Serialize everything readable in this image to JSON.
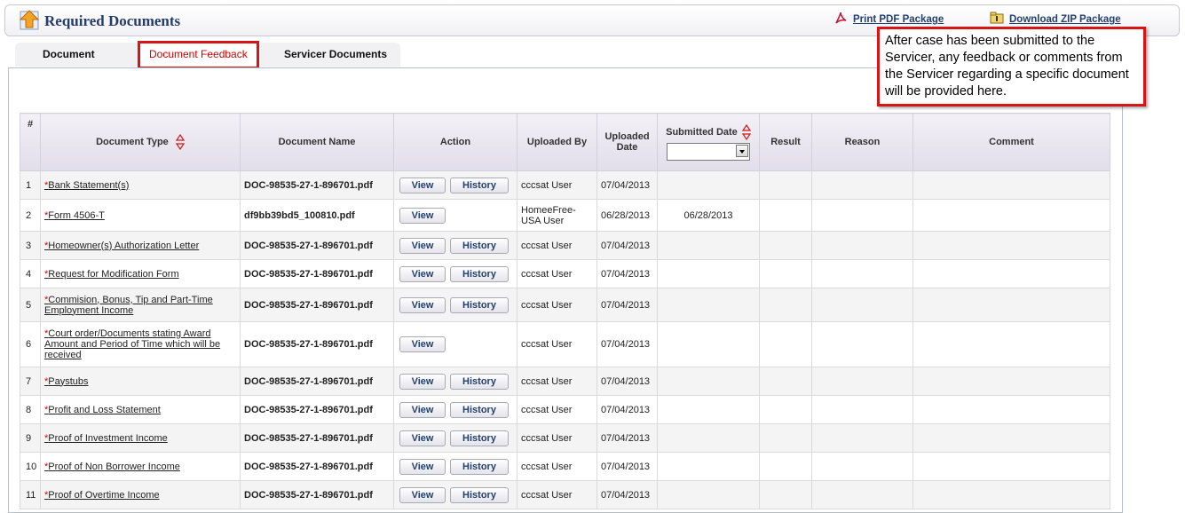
{
  "header": {
    "title": "Required Documents",
    "print_pdf": "Print PDF Package",
    "download_zip": "Download ZIP Package"
  },
  "tabs": [
    {
      "label": "Document"
    },
    {
      "label": "Document Feedback"
    },
    {
      "label": "Servicer Documents"
    }
  ],
  "callout": {
    "text": "After case has been submitted to the Servicer, any feedback or comments from the Servicer regarding a specific document will be provided here."
  },
  "table": {
    "columns": {
      "num": "#",
      "doc_type": "Document Type",
      "doc_name": "Document Name",
      "action": "Action",
      "uploaded_by": "Uploaded By",
      "uploaded_date": "Uploaded Date",
      "submitted_date": "Submitted Date",
      "result": "Result",
      "reason": "Reason",
      "comment": "Comment"
    },
    "view_label": "View",
    "history_label": "History",
    "required_mark": "*",
    "rows": [
      {
        "num": "1",
        "type": "Bank Statement(s)",
        "name": "DOC-98535-27-1-896701.pdf",
        "history": true,
        "by": "cccsat User",
        "uploaded": "07/04/2013",
        "submitted": ""
      },
      {
        "num": "2",
        "type": "Form 4506-T",
        "name": "df9bb39bd5_100810.pdf",
        "history": false,
        "by": "HomeeFree-USA User",
        "uploaded": "06/28/2013",
        "submitted": "06/28/2013"
      },
      {
        "num": "3",
        "type": "Homeowner(s) Authorization Letter",
        "name": "DOC-98535-27-1-896701.pdf",
        "history": true,
        "by": "cccsat User",
        "uploaded": "07/04/2013",
        "submitted": ""
      },
      {
        "num": "4",
        "type": "Request for Modification Form",
        "name": "DOC-98535-27-1-896701.pdf",
        "history": true,
        "by": "cccsat User",
        "uploaded": "07/04/2013",
        "submitted": ""
      },
      {
        "num": "5",
        "type": "Commision, Bonus, Tip and Part-Time Employment Income",
        "name": "DOC-98535-27-1-896701.pdf",
        "history": true,
        "by": "cccsat User",
        "uploaded": "07/04/2013",
        "submitted": ""
      },
      {
        "num": "6",
        "type": "Court order/Documents stating Award Amount and Period of Time which will be received",
        "name": "DOC-98535-27-1-896701.pdf",
        "history": false,
        "by": "cccsat User",
        "uploaded": "07/04/2013",
        "submitted": ""
      },
      {
        "num": "7",
        "type": "Paystubs",
        "name": "DOC-98535-27-1-896701.pdf",
        "history": true,
        "by": "cccsat User",
        "uploaded": "07/04/2013",
        "submitted": ""
      },
      {
        "num": "8",
        "type": "Profit and Loss Statement",
        "name": "DOC-98535-27-1-896701.pdf",
        "history": true,
        "by": "cccsat User",
        "uploaded": "07/04/2013",
        "submitted": ""
      },
      {
        "num": "9",
        "type": "Proof of Investment Income",
        "name": "DOC-98535-27-1-896701.pdf",
        "history": true,
        "by": "cccsat User",
        "uploaded": "07/04/2013",
        "submitted": ""
      },
      {
        "num": "10",
        "type": "Proof of Non Borrower Income",
        "name": "DOC-98535-27-1-896701.pdf",
        "history": true,
        "by": "cccsat User",
        "uploaded": "07/04/2013",
        "submitted": ""
      },
      {
        "num": "11",
        "type": "Proof of Overtime Income",
        "name": "DOC-98535-27-1-896701.pdf",
        "history": true,
        "by": "cccsat User",
        "uploaded": "07/04/2013",
        "submitted": ""
      }
    ]
  },
  "colors": {
    "accent": "#23406f",
    "link": "#1d4f8a",
    "highlight": "#d41616",
    "required": "#d40000"
  }
}
